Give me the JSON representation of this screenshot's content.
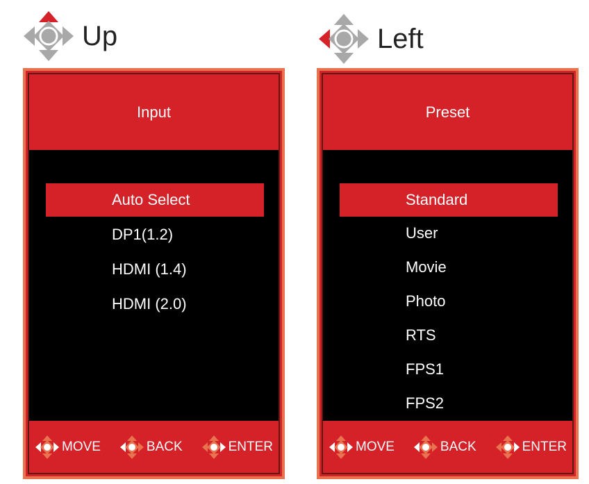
{
  "colors": {
    "accent_red": "#d52128",
    "panel_border": "#e8734e",
    "hint_icon_orange": "#e8734e",
    "dpad_gray": "#a8a8a8",
    "dpad_active_red": "#d52128",
    "menu_background": "#000000"
  },
  "left": {
    "direction": {
      "label": "Up",
      "icon": "dpad-up-icon"
    },
    "title": "Input",
    "items": [
      {
        "label": "Auto Select",
        "selected": true
      },
      {
        "label": "DP1(1.2)",
        "selected": false
      },
      {
        "label": "HDMI (1.4)",
        "selected": false
      },
      {
        "label": "HDMI (2.0)",
        "selected": false
      }
    ],
    "footer": {
      "move": "MOVE",
      "back": "BACK",
      "enter": "ENTER"
    }
  },
  "right": {
    "direction": {
      "label": "Left",
      "icon": "dpad-left-icon"
    },
    "title": "Preset",
    "items": [
      {
        "label": "Standard",
        "selected": true
      },
      {
        "label": "User",
        "selected": false
      },
      {
        "label": "Movie",
        "selected": false
      },
      {
        "label": "Photo",
        "selected": false
      },
      {
        "label": "RTS",
        "selected": false
      },
      {
        "label": "FPS1",
        "selected": false
      },
      {
        "label": "FPS2",
        "selected": false
      }
    ],
    "footer": {
      "move": "MOVE",
      "back": "BACK",
      "enter": "ENTER"
    }
  }
}
